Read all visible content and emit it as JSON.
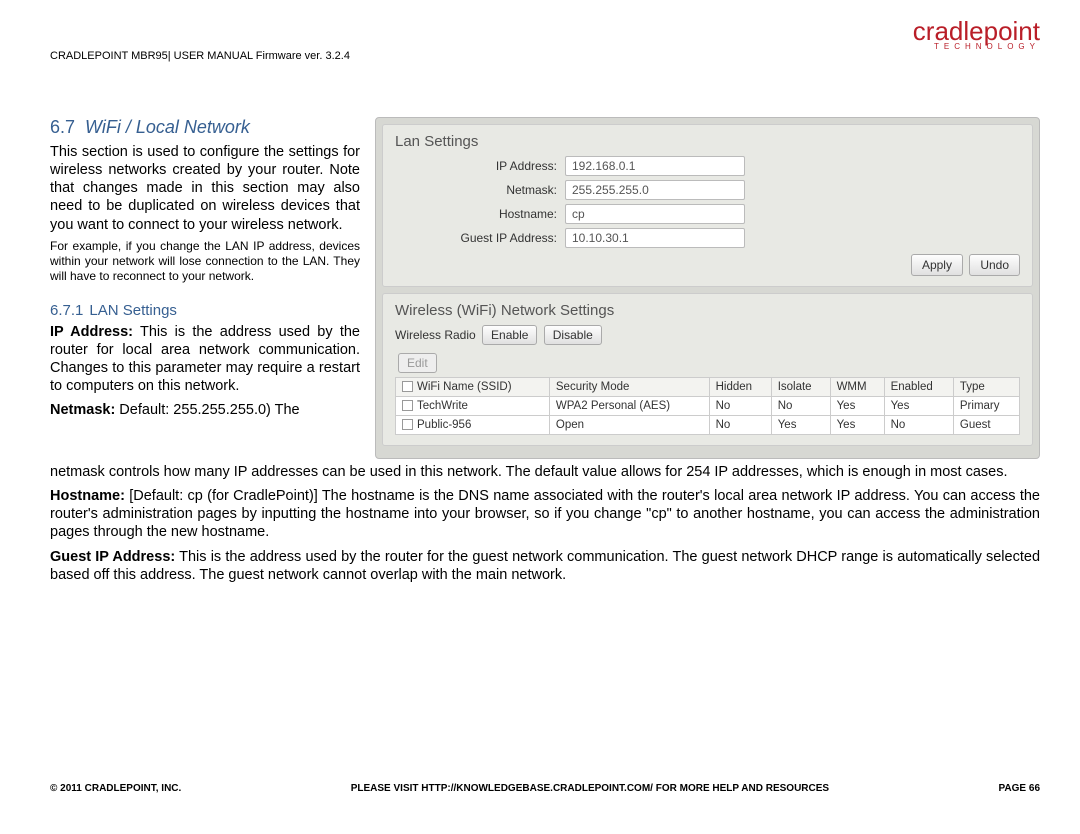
{
  "header": {
    "breadcrumb": "CRADLEPOINT MBR95| USER MANUAL Firmware ver. 3.2.4",
    "logo_main": "cradlepoint",
    "logo_sub": "TECHNOLOGY"
  },
  "section": {
    "num": "6.7",
    "title": "WiFi / Local Network",
    "intro": "This section is used to configure the settings for wireless networks created by your router. Note that changes made in this section may also need to be duplicated on wireless devices that you want to connect to your wireless network.",
    "example": "For example, if you change the LAN IP address, devices within your network will lose connection to the LAN. They will have to reconnect to your network."
  },
  "sub": {
    "num": "6.7.1",
    "title": "LAN Settings",
    "ip_label": "IP Address:",
    "ip_text": " This is the address used by the router for local area network communication. Changes to this parameter may require a restart to computers on this network.",
    "netmask_label": "Netmask:",
    "netmask_trail": " Default: 255.255.255.0) The"
  },
  "panel": {
    "lan_title": "Lan Settings",
    "fields": {
      "ip_label": "IP Address:",
      "ip_val": "192.168.0.1",
      "mask_label": "Netmask:",
      "mask_val": "255.255.255.0",
      "host_label": "Hostname:",
      "host_val": "cp",
      "guest_label": "Guest IP Address:",
      "guest_val": "10.10.30.1"
    },
    "apply": "Apply",
    "undo": "Undo",
    "wifi_title": "Wireless (WiFi) Network Settings",
    "radio_label": "Wireless Radio",
    "enable": "Enable",
    "disable": "Disable",
    "edit": "Edit",
    "cols": [
      "WiFi Name (SSID)",
      "Security Mode",
      "Hidden",
      "Isolate",
      "WMM",
      "Enabled",
      "Type"
    ],
    "rows": [
      {
        "ssid": "TechWrite",
        "sec": "WPA2 Personal (AES)",
        "hidden": "No",
        "iso": "No",
        "wmm": "Yes",
        "en": "Yes",
        "type": "Primary"
      },
      {
        "ssid": "Public-956",
        "sec": "Open",
        "hidden": "No",
        "iso": "Yes",
        "wmm": "Yes",
        "en": "No",
        "type": "Guest"
      }
    ]
  },
  "paras": {
    "netmask_cont": "netmask controls how many IP addresses can be used in this network. The default value allows for 254 IP addresses, which is enough in most cases.",
    "hostname_label": "Hostname:",
    "hostname": " [Default: cp (for CradlePoint)] The hostname is the DNS name associated with the router's local area network IP address. You can access the router's administration pages by inputting the hostname into your browser, so if you change \"cp\" to another hostname, you can access the administration pages through the new hostname.",
    "guest_label": "Guest IP Address:",
    "guest": " This is the address used by the router for the guest network communication. The guest network DHCP range is automatically selected based off this address. The guest network cannot overlap with the main network."
  },
  "footer": {
    "left": "© 2011 CRADLEPOINT, INC.",
    "mid_pre": "PLEASE VISIT ",
    "mid_link": "HTTP://KNOWLEDGEBASE.CRADLEPOINT.COM/",
    "mid_post": " FOR MORE HELP AND RESOURCES",
    "right": "PAGE 66"
  }
}
